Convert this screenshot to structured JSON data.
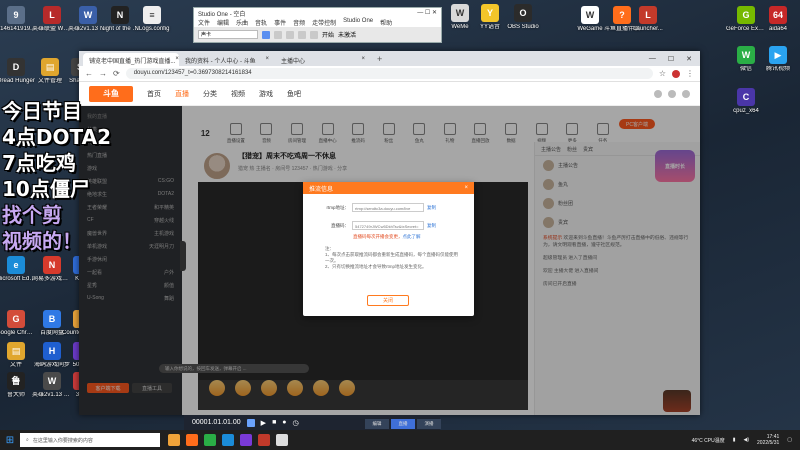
{
  "desktop": {
    "left_icons": [
      {
        "label": "3146141919...",
        "color": "#5b6f89",
        "glyph": "9"
      },
      {
        "label": "英雄联盟 WeGame版",
        "color": "#b72a2a",
        "glyph": "L"
      },
      {
        "label": "英雄2v1.13 英雄联盟",
        "color": "#3a5fa8",
        "glyph": "W"
      },
      {
        "label": "Night of the Dead",
        "color": "#222222",
        "glyph": "N"
      },
      {
        "label": "NLogs.config",
        "color": "#eeeeee",
        "glyph": "≡"
      },
      {
        "label": "Dread Hunger",
        "color": "#333333",
        "glyph": "D"
      },
      {
        "label": "文件管理",
        "color": "#e0a62e",
        "glyph": "▤"
      },
      {
        "label": "Shadow",
        "color": "#444444",
        "glyph": "S"
      },
      {
        "label": "Microsoft Edge",
        "color": "#1b8cd8",
        "glyph": "e"
      },
      {
        "label": "网易多游戏平台",
        "color": "#d63a2c",
        "glyph": "N"
      },
      {
        "label": "Kook",
        "color": "#2f6cd8",
        "glyph": "K"
      },
      {
        "label": "Google Chrome",
        "color": "#d34c3a",
        "glyph": "G"
      },
      {
        "label": "百度网盘",
        "color": "#2f79e5",
        "glyph": "B"
      },
      {
        "label": "Counter Global",
        "color": "#e8a33a",
        "glyph": "C"
      },
      {
        "label": "文件",
        "color": "#e0a62e",
        "glyph": "▤"
      },
      {
        "label": "海鸥游戏同步",
        "color": "#1f5fcf",
        "glyph": "H"
      },
      {
        "label": "50同步",
        "color": "#6a3ac8",
        "glyph": "5"
      },
      {
        "label": "鲁大师",
        "color": "#222222",
        "glyph": "鲁"
      },
      {
        "label": "英雄2v1.13 英雄战役",
        "color": "#4a4a4a",
        "glyph": "W"
      },
      {
        "label": "3PM",
        "color": "#c93a3a",
        "glyph": "3"
      }
    ],
    "top_icons": [
      {
        "label": "WeMe",
        "color": "#d9d9d9",
        "glyph": "W"
      },
      {
        "label": "YY语音",
        "color": "#f3c52a",
        "glyph": "Y"
      },
      {
        "label": "OBS Studio",
        "color": "#2b2b2b",
        "glyph": "O"
      }
    ],
    "right_icons": [
      {
        "label": "WeGame",
        "color": "#ffffff",
        "glyph": "W"
      },
      {
        "label": "斗鱼直播伴侣",
        "color": "#ff6d1b",
        "glyph": "?"
      },
      {
        "label": "Launcher...",
        "color": "#c33a2a",
        "glyph": "L"
      },
      {
        "label": "GeForce Experience",
        "color": "#76b900",
        "glyph": "G"
      },
      {
        "label": "aida64",
        "color": "#c62828",
        "glyph": "64"
      },
      {
        "label": "微信",
        "color": "#2aae46",
        "glyph": "W"
      },
      {
        "label": "腾讯视频",
        "color": "#2aa3f0",
        "glyph": "▶"
      },
      {
        "label": "cpuz_x64",
        "color": "#4a36a8",
        "glyph": "C"
      }
    ]
  },
  "overlay": {
    "lines": [
      "今日节目",
      "4点DOTA2",
      "7点吃鸡",
      "10点僵尸"
    ],
    "purple_lines": [
      "找个剪",
      "视频的！"
    ]
  },
  "studio_window": {
    "title": "Studio One - 空白",
    "menu": [
      "文件",
      "编辑",
      "乐曲",
      "音轨",
      "事件",
      "音频",
      "走带控制",
      "Studio One",
      "帮助"
    ],
    "select_label": "声卡",
    "status": "开始",
    "status2": "未激活"
  },
  "browser": {
    "tabs": [
      {
        "label": "铺览老中国直播_热门游戏直播..."
      },
      {
        "label": "我的资料 - 个人中心 - 斗鱼"
      },
      {
        "label": "主播中心"
      }
    ],
    "url": "douyu.com/123457_t=0.3697308214161834",
    "site": {
      "logo": "斗鱼",
      "nav": [
        "首页",
        "直播",
        "分类",
        "视频",
        "游戏",
        "鱼吧"
      ],
      "active_nav": "直播"
    },
    "sidebar": {
      "rows": [
        {
          "left": "我的直播",
          "right": ""
        },
        {
          "left": "分类",
          "right": ""
        },
        {
          "left": "关注",
          "right": ""
        },
        {
          "left": "热门直播",
          "right": ""
        },
        {
          "left": "游戏",
          "right": ""
        },
        {
          "left": "英雄联盟",
          "right": "CS:GO"
        },
        {
          "left": "绝地求生",
          "right": "DOTA2"
        },
        {
          "left": "王者荣耀",
          "right": "和平精英"
        },
        {
          "left": "CF",
          "right": "穿越火线"
        },
        {
          "left": "魔兽世界",
          "right": "主机游戏"
        },
        {
          "left": "单机游戏",
          "right": "天涯明月刀"
        },
        {
          "left": "手游休闲",
          "right": ""
        },
        {
          "left": "一起看",
          "right": "户外"
        },
        {
          "left": "星秀",
          "right": "颜值"
        },
        {
          "left": "U-Song",
          "right": "舞蹈"
        }
      ],
      "btn_primary": "客户端下载",
      "btn_secondary": "直播工具"
    },
    "toolbar": {
      "count": "12",
      "items": [
        "直播设置",
        "音频",
        "房间管理",
        "直播中心",
        "推流码",
        "粉丝",
        "鱼丸",
        "礼物",
        "直播回放",
        "数据",
        "视频",
        "更多",
        "任务"
      ],
      "pc_btn": "PC客户端"
    },
    "streamer": {
      "title": "【猎宠】周末不吃鸡周一不休息",
      "meta": "猎宠 热 主播名 · 房间号 123457 · 热门游戏 · 分享"
    },
    "player": {
      "chat_placeholder": "输入你想说的，按回车发送，弹幕开启 ..."
    },
    "right_panel": {
      "tabs": [
        "主播公告",
        "粉丝",
        "贵宾"
      ],
      "users": [
        "主播公告",
        "鱼丸",
        "粉丝团",
        "贵宾"
      ],
      "notice_head": "系统提示",
      "notice": "欢迎来到斗鱼直播！斗鱼严厉打击直播中的低俗、违规等行为，请文明观看直播，遵守社区规范。",
      "badge": "直播时长",
      "bottom_note": "房间已开启直播",
      "notice_lines": [
        "超级管理员 进入了直播间",
        "欢迎 主播大佬 进入直播间"
      ]
    },
    "modal": {
      "title": "推流信息",
      "close_x": "×",
      "rtmp_label": "rtmp地址：",
      "rtmp_value": "rtmp://sendtc3a.douyu.com/live",
      "key_label": "直播码：",
      "key_value": "5472749rJWCw5DkhTsv&txSecret=",
      "key_hidden": "●●●●●●",
      "copy": "复制",
      "warn": "直播码每次开播会变更，",
      "warn_link": "点此了解",
      "notes": [
        "注：",
        "1、每次点击获取推流码都会重新生成直播码，每个直播码仅能使用一次。",
        "2、只有切换推流地址才会导致rtmp地址发生变化。"
      ],
      "close_btn": "关闭"
    }
  },
  "recorder": {
    "time": "00001.01.01.00",
    "modes": [
      "编辑",
      "直播",
      "演播"
    ],
    "active_mode": "直播"
  },
  "taskbar": {
    "search_placeholder": "在这里输入你要搜索的内容",
    "apps": [
      "#f0a33a",
      "#ff6d1b",
      "#2aae46",
      "#1b8cd8",
      "#7a3ad8",
      "#c33a2a",
      "#dddddd"
    ],
    "temp": "46°C",
    "temp_label": "CPU温度",
    "time": "17:41",
    "date": "2022/5/31"
  }
}
